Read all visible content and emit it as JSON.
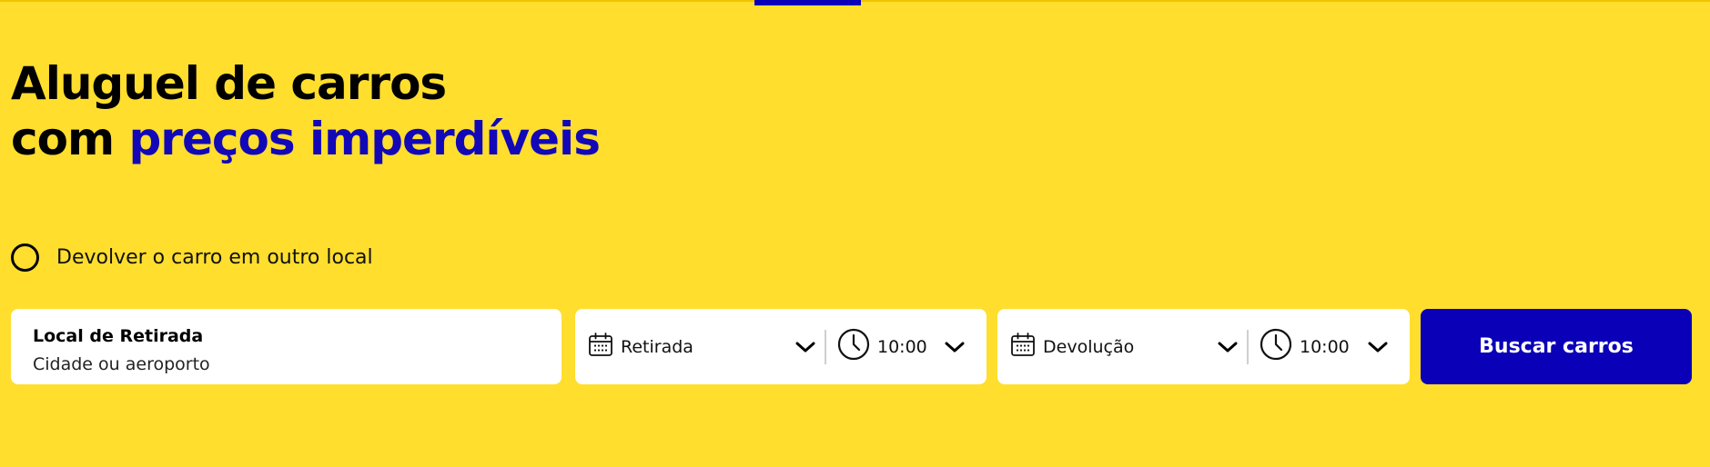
{
  "hero": {
    "title_line1": "Aluguel de carros",
    "title_line2_prefix": "com ",
    "title_line2_accent": "preços imperdíveis"
  },
  "options": {
    "return_elsewhere_label": "Devolver o carro em outro local",
    "return_elsewhere_checked": false
  },
  "search_form": {
    "pickup_location": {
      "label": "Local de Retirada",
      "placeholder": "Cidade ou aeroporto",
      "value": ""
    },
    "pickup": {
      "date_label": "Retirada",
      "time": "10:00"
    },
    "dropoff": {
      "date_label": "Devolução",
      "time": "10:00"
    },
    "submit_label": "Buscar carros"
  },
  "icons": {
    "date": "calendar-icon",
    "time": "clock-icon",
    "dropdown": "chevron-down-icon"
  },
  "colors": {
    "background": "#ffde2e",
    "accent": "#0a00b8",
    "title_accent": "#1208b8",
    "field_background": "#ffffff"
  }
}
